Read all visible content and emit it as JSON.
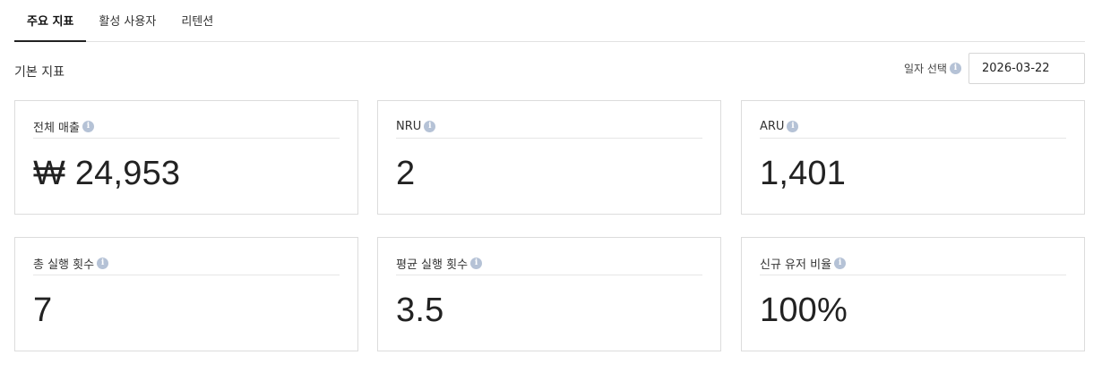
{
  "tabs": [
    {
      "label": "주요 지표",
      "active": true
    },
    {
      "label": "활성 사용자",
      "active": false
    },
    {
      "label": "리텐션",
      "active": false
    }
  ],
  "section": {
    "title": "기본 지표"
  },
  "date_picker": {
    "label": "일자 선택",
    "value": "2026-03-22"
  },
  "cards": [
    {
      "title": "전체 매출",
      "value": "₩ 24,953"
    },
    {
      "title": "NRU",
      "value": "2"
    },
    {
      "title": "ARU",
      "value": "1,401"
    },
    {
      "title": "총 실행 횟수",
      "value": "7"
    },
    {
      "title": "평균 실행 횟수",
      "value": "3.5"
    },
    {
      "title": "신규 유저 비율",
      "value": "100%"
    }
  ],
  "icons": {
    "info": "info-icon",
    "info_glyph": "i",
    "info_color": "#b5c2d6"
  }
}
